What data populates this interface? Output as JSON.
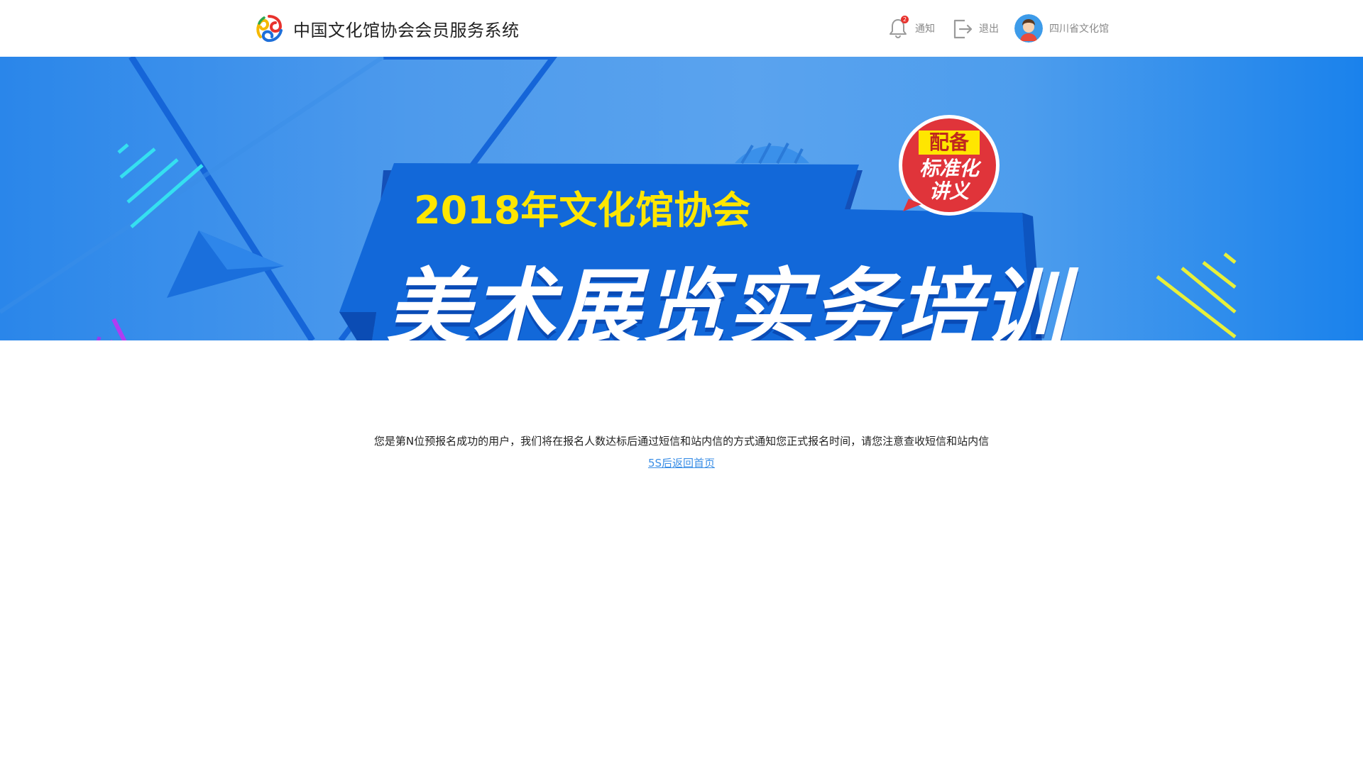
{
  "header": {
    "title": "中国文化馆协会会员服务系统",
    "notification_label": "通知",
    "notification_count": "2",
    "logout_label": "退出",
    "user_name": "四川省文化馆"
  },
  "banner": {
    "subtitle": "2018年文化馆协会",
    "title": "美术展览实务培训",
    "bubble_top": "配备",
    "bubble_line1": "标准化",
    "bubble_line2": "讲义"
  },
  "main": {
    "message": "您是第N位预报名成功的用户，我们将在报名人数达标后通过短信和站内信的方式通知您正式报名时间，请您注意查收短信和站内信",
    "back_link": "5S后返回首页"
  },
  "colors": {
    "accent_blue": "#3a8ee6",
    "badge_red": "#e8322d",
    "banner_yellow": "#ffe600"
  },
  "icons": {
    "logo": "association-logo-icon",
    "notification": "bell-icon",
    "logout": "logout-icon",
    "avatar": "user-avatar"
  }
}
